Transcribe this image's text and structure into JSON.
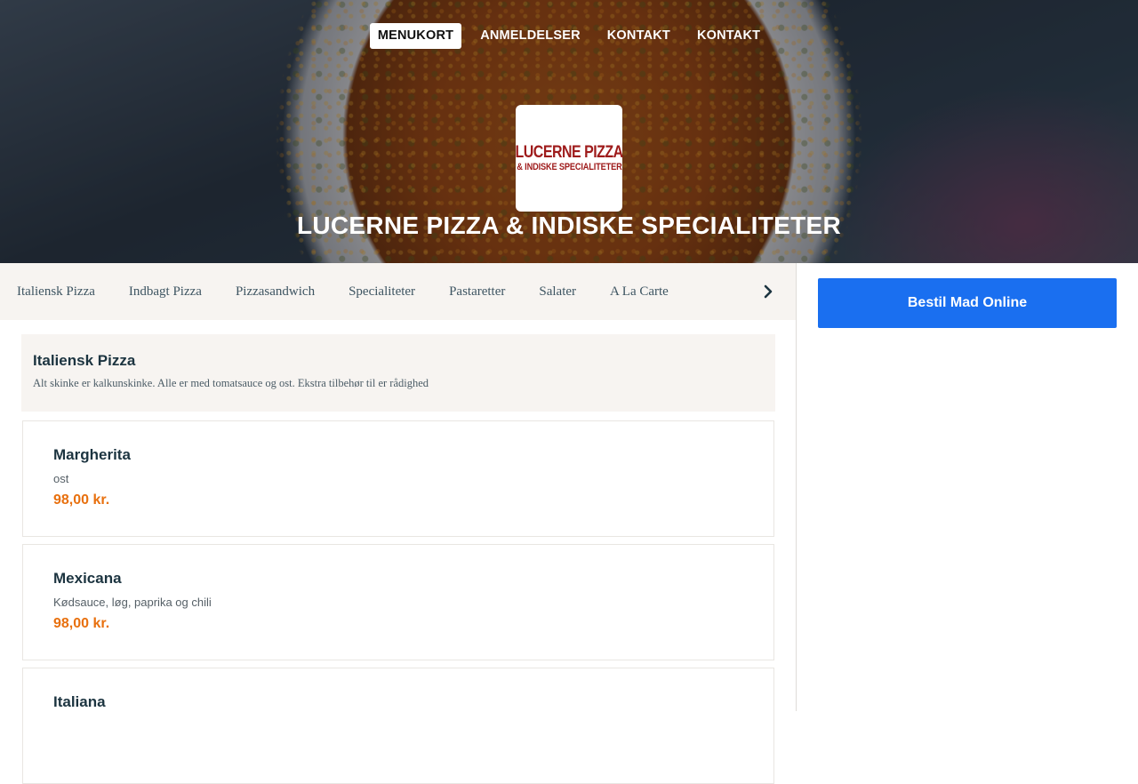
{
  "nav": {
    "items": [
      {
        "label": "MENUKORT",
        "active": true
      },
      {
        "label": "ANMELDELSER",
        "active": false
      },
      {
        "label": "KONTAKT",
        "active": false
      },
      {
        "label": "KONTAKT",
        "active": false
      }
    ]
  },
  "logo": {
    "line1": "LUCERNE PIZZA",
    "line2": "& INDISKE SPECIALITETER",
    "color": "#9e1b1b"
  },
  "restaurant": {
    "name": "LUCERNE PIZZA & INDISKE SPECIALITETER"
  },
  "categories": {
    "items": [
      "Italiensk Pizza",
      "Indbagt Pizza",
      "Pizzasandwich",
      "Specialiteter",
      "Pastaretter",
      "Salater",
      "A La Carte"
    ],
    "next_icon": "chevron-right-icon"
  },
  "section": {
    "title": "Italiensk Pizza",
    "description": "Alt skinke er kalkunskinke. Alle er med tomatsauce og ost. Ekstra tilbehør til er rådighed"
  },
  "menu_items": [
    {
      "name": "Margherita",
      "description": "ost",
      "price": "98,00 kr."
    },
    {
      "name": "Mexicana",
      "description": "Kødsauce, løg, paprika og chili",
      "price": "98,00 kr."
    },
    {
      "name": "Italiana",
      "description": "",
      "price": ""
    }
  ],
  "sidebar": {
    "order_button": "Bestil Mad Online"
  },
  "colors": {
    "accent": "#1a6ff0",
    "price": "#e8700e",
    "heading": "#1c3440",
    "panel": "#f7f4f1"
  }
}
